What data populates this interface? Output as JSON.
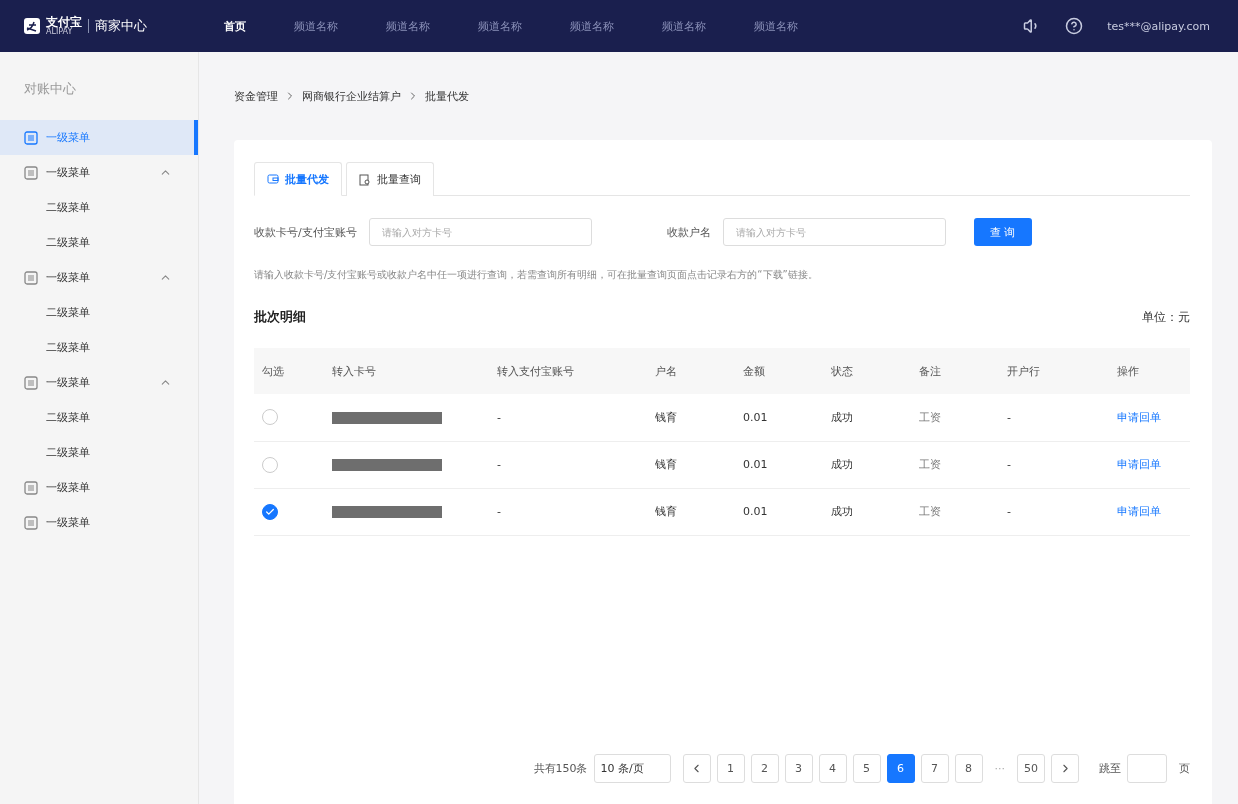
{
  "header": {
    "logo": {
      "brand": "支付宝",
      "brand_sub": "ALIPAY",
      "product": "商家中心"
    },
    "nav": [
      {
        "label": "首页",
        "selected": true
      },
      {
        "label": "频道名称",
        "selected": false
      },
      {
        "label": "频道名称",
        "selected": false
      },
      {
        "label": "频道名称",
        "selected": false
      },
      {
        "label": "频道名称",
        "selected": false
      },
      {
        "label": "频道名称",
        "selected": false
      },
      {
        "label": "频道名称",
        "selected": false
      }
    ],
    "user": "tes***@alipay.com"
  },
  "sidebar": {
    "title": "对账中心",
    "items": [
      {
        "label": "一级菜单",
        "selected": true
      },
      {
        "label": "一级菜单",
        "selected": false,
        "expanded": true,
        "children": [
          {
            "label": "二级菜单",
            "selected": false
          },
          {
            "label": "二级菜单",
            "selected": false
          }
        ]
      },
      {
        "label": "一级菜单",
        "selected": false,
        "expanded": true,
        "children": [
          {
            "label": "二级菜单",
            "selected": false
          },
          {
            "label": "二级菜单",
            "selected": false
          }
        ]
      },
      {
        "label": "一级菜单",
        "selected": false,
        "expanded": true,
        "children": [
          {
            "label": "二级菜单",
            "selected": false
          },
          {
            "label": "二级菜单",
            "selected": false
          }
        ]
      },
      {
        "label": "一级菜单",
        "selected": false
      },
      {
        "label": "一级菜单",
        "selected": false
      }
    ]
  },
  "breadcrumb": [
    "资金管理",
    "网商银行企业结算户",
    "批量代发"
  ],
  "tabs": [
    {
      "label": "批量代发",
      "selected": true,
      "kind": "wallet"
    },
    {
      "label": "批量查询",
      "selected": false,
      "kind": "search"
    }
  ],
  "filters": [
    {
      "label": "收款卡号/支付宝账号",
      "placeholder": "请输入对方卡号"
    },
    {
      "label": "收款户名",
      "placeholder": "请输入对方卡号"
    }
  ],
  "query_button": "查 询",
  "hint": "请输入收款卡号/支付宝账号或收款户名中任一项进行查询，若需查询所有明细，可在批量查询页面点击记录右方的“下载”链接。",
  "section_title": "批次明细",
  "unit": "单位：元",
  "table": {
    "columns": [
      "勾选",
      "转入卡号",
      "转入支付宝账号",
      "户名",
      "金额",
      "状态",
      "备注",
      "开户行",
      "操作"
    ],
    "rows": [
      {
        "checked": false,
        "alipay_account": "-",
        "name": "钱育",
        "amount": "0.01",
        "status": "成功",
        "remark": "工资",
        "bank": "-",
        "action": "申请回单"
      },
      {
        "checked": false,
        "alipay_account": "-",
        "name": "钱育",
        "amount": "0.01",
        "status": "成功",
        "remark": "工资",
        "bank": "-",
        "action": "申请回单"
      },
      {
        "checked": true,
        "alipay_account": "-",
        "name": "钱育",
        "amount": "0.01",
        "status": "成功",
        "remark": "工资",
        "bank": "-",
        "action": "申请回单"
      }
    ]
  },
  "pagination": {
    "total": "共有150条",
    "page_size": "10 条/页",
    "pages": [
      {
        "label": "1",
        "selected": false
      },
      {
        "label": "2",
        "selected": false
      },
      {
        "label": "3",
        "selected": false
      },
      {
        "label": "4",
        "selected": false
      },
      {
        "label": "5",
        "selected": false
      },
      {
        "label": "6",
        "selected": true
      },
      {
        "label": "7",
        "selected": false
      },
      {
        "label": "8",
        "selected": false
      }
    ],
    "ellipsis": "···",
    "last_page": "50",
    "jump_label": "跳至",
    "page_unit": "页"
  }
}
